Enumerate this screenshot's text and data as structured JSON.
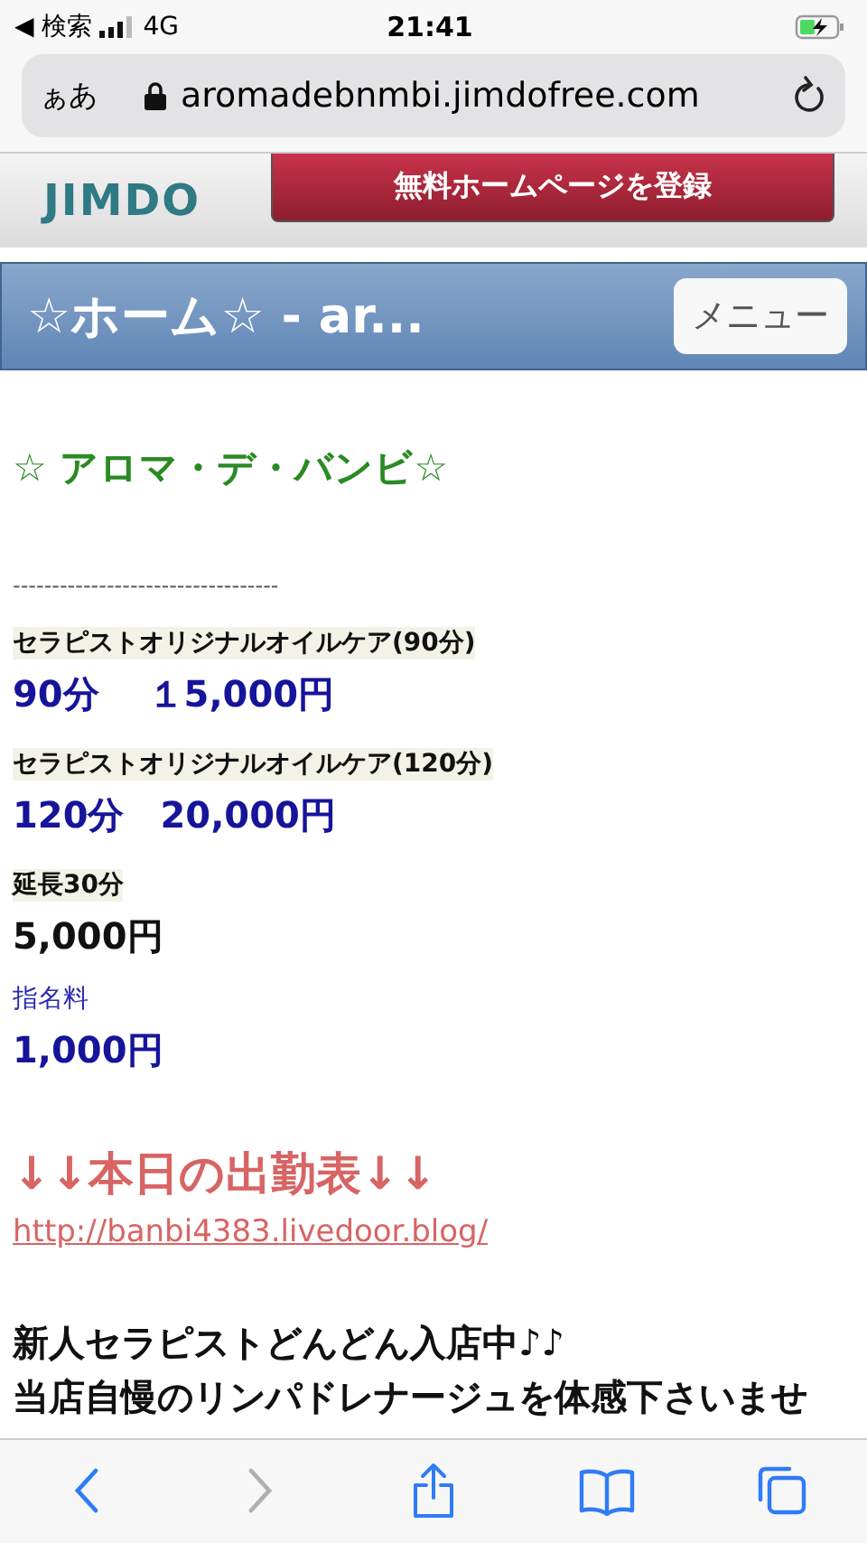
{
  "status_bar": {
    "back_label": "◀ 検索",
    "network": "4G",
    "time": "21:41"
  },
  "address_bar": {
    "text_size": "ぁあ",
    "url": "aromadebnmbi.jimdofree.com"
  },
  "banner": {
    "logo": "JIMDO",
    "button": "無料ホームページを登録"
  },
  "header": {
    "title": "☆ホーム☆ - ar...",
    "menu_button": "メニュー"
  },
  "content": [
    {
      "kind": "title",
      "text": "☆ アロマ・デ・バンビ☆"
    },
    {
      "kind": "rule",
      "text": "----------------------------------"
    },
    {
      "kind": "label",
      "text": "セラピストオリジナルオイルケア(90分)"
    },
    {
      "kind": "price",
      "text": "90分　 １5,000円"
    },
    {
      "kind": "label",
      "text": "セラピストオリジナルオイルケア(120分)"
    },
    {
      "kind": "price",
      "text": "120分　20,000円"
    },
    {
      "kind": "label",
      "text": "延長30分"
    },
    {
      "kind": "amount",
      "text": "5,000円"
    },
    {
      "kind": "note",
      "text": "指名料"
    },
    {
      "kind": "price",
      "text": "1,000円"
    },
    {
      "kind": "schedule",
      "text": "↓↓本日の出勤表↓↓"
    },
    {
      "kind": "link",
      "text": "http://banbi4383.livedoor.blog/"
    },
    {
      "kind": "text",
      "text": "新人セラピストどんどん入店中♪♪"
    },
    {
      "kind": "text",
      "text": "当店自慢のリンパドレナージュを体感下さいませ"
    }
  ],
  "toolbar": [
    {
      "kind": "back",
      "disabled": false
    },
    {
      "kind": "forward",
      "disabled": true
    },
    {
      "kind": "share",
      "disabled": false
    },
    {
      "kind": "bookmarks",
      "disabled": false
    },
    {
      "kind": "tabs",
      "disabled": false
    }
  ]
}
